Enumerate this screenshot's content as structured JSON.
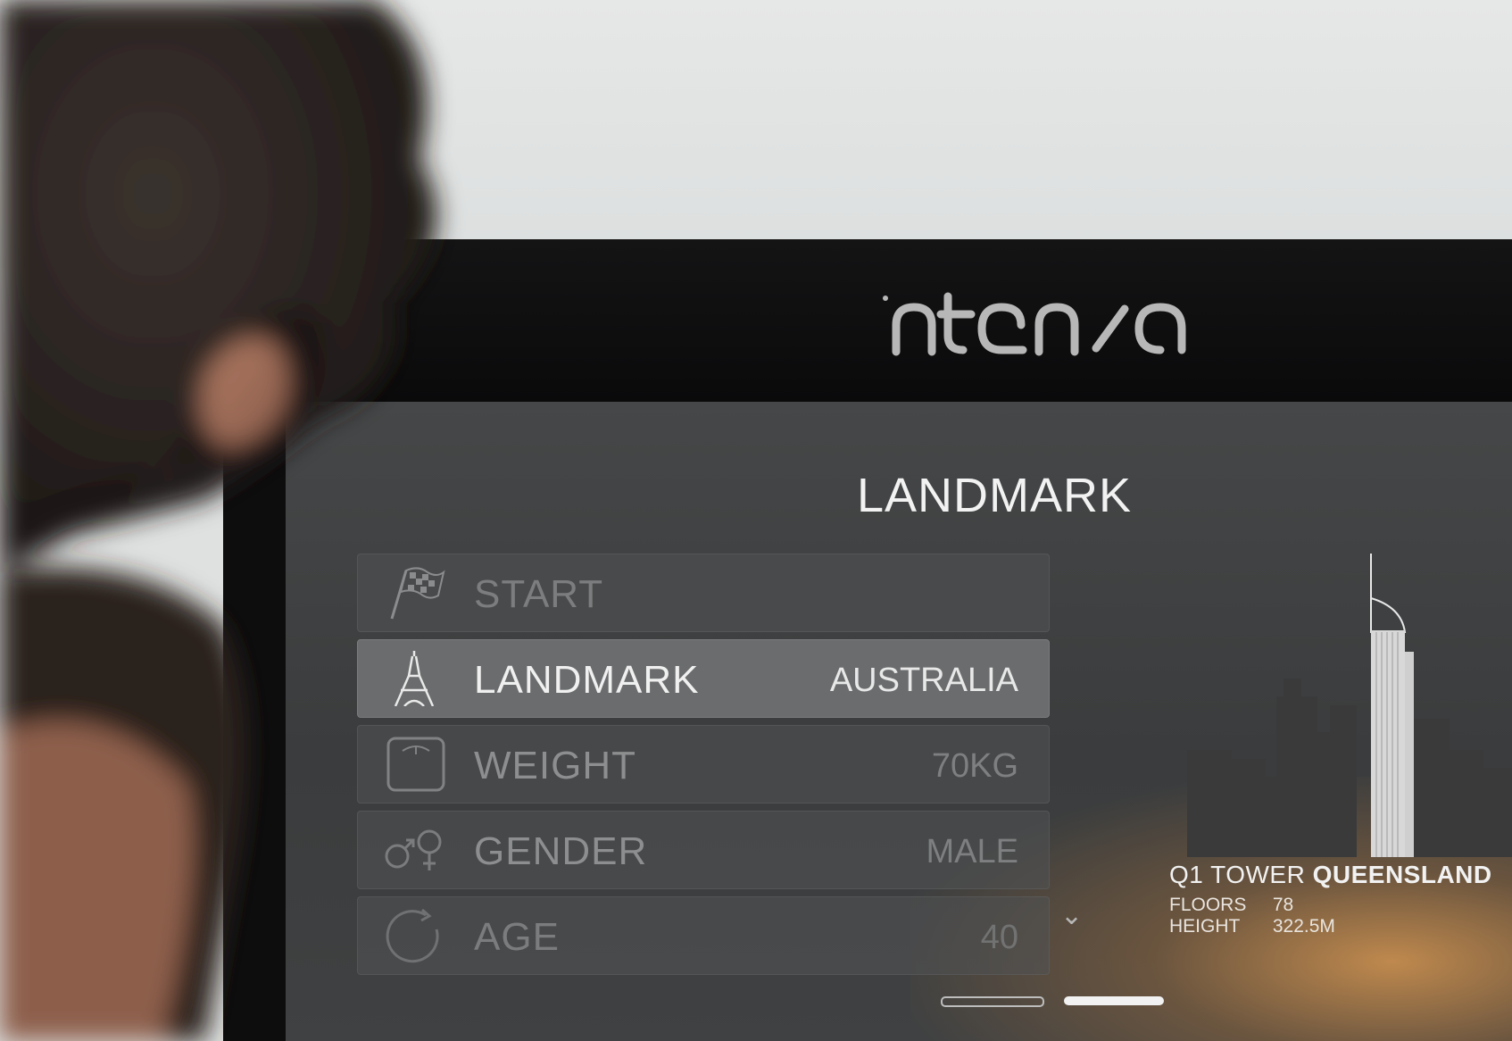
{
  "brand": {
    "logo_text": "intensa"
  },
  "screen": {
    "title": "LANDMARK",
    "menu": [
      {
        "label": "START",
        "value": "",
        "icon": "checkered-flag-icon",
        "active": false
      },
      {
        "label": "LANDMARK",
        "value": "AUSTRALIA",
        "icon": "eiffel-tower-icon",
        "active": true
      },
      {
        "label": "WEIGHT",
        "value": "70KG",
        "icon": "scale-icon",
        "active": false
      },
      {
        "label": "GENDER",
        "value": "MALE",
        "icon": "gender-icon",
        "active": false
      },
      {
        "label": "AGE",
        "value": "40",
        "icon": "age-cycle-icon",
        "active": false
      }
    ],
    "more_indicator": "chevron-down-icon",
    "landmark": {
      "name": "Q1 TOWER",
      "region": "QUEENSLAND",
      "floors_label": "FLOORS",
      "floors_value": "78",
      "height_label": "HEIGHT",
      "height_value": "322.5M"
    },
    "pager": {
      "pages": 2,
      "current": 2
    }
  },
  "colors": {
    "accent_glow": "#d6964f",
    "active_row": "#6a6c6d",
    "text_primary": "#f2f2f2"
  }
}
